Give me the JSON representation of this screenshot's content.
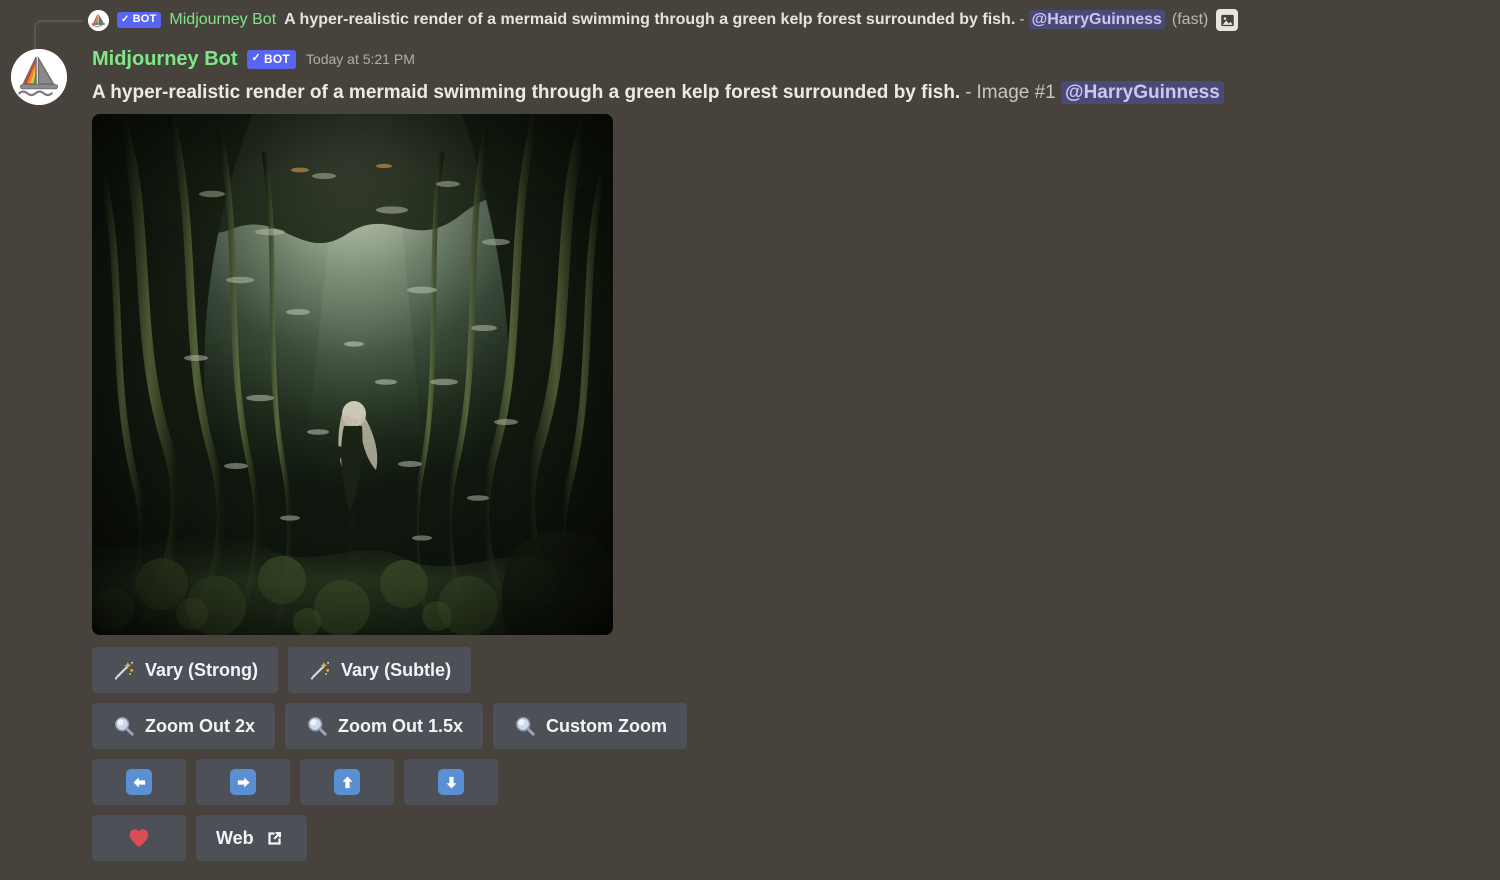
{
  "reply_reference": {
    "avatar_icon": "midjourney-boat-avatar-icon",
    "bot_badge": {
      "check": "✓",
      "label": "BOT"
    },
    "username": "Midjourney Bot",
    "prompt": "A hyper-realistic render of a mermaid swimming through a green kelp forest surrounded by fish.",
    "dash": "-",
    "mention": "@HarryGuinness",
    "mode": "(fast)",
    "attachment_icon": "image-attachment-icon"
  },
  "message": {
    "avatar_icon": "midjourney-boat-avatar-icon",
    "author": "Midjourney Bot",
    "bot_badge": {
      "check": "✓",
      "label": "BOT"
    },
    "timestamp": "Today at 5:21 PM",
    "prompt": "A hyper-realistic render of a mermaid swimming through a green kelp forest surrounded by fish.",
    "dash": "-",
    "image_number": "Image #1",
    "mention": "@HarryGuinness",
    "attachment": {
      "alt": "A hyper-realistic render of a mermaid swimming through a green kelp forest surrounded by fish.",
      "width": "521",
      "height": "521"
    }
  },
  "action_rows": [
    {
      "buttons": [
        {
          "name": "vary-strong",
          "icon": "sparkles-wand-icon",
          "label": "Vary (Strong)"
        },
        {
          "name": "vary-subtle",
          "icon": "sparkles-wand-icon",
          "label": "Vary (Subtle)"
        }
      ]
    },
    {
      "buttons": [
        {
          "name": "zoom-out-2x",
          "icon": "magnifying-glass-icon",
          "label": "Zoom Out 2x"
        },
        {
          "name": "zoom-out-1-5x",
          "icon": "magnifying-glass-icon",
          "label": "Zoom Out 1.5x"
        },
        {
          "name": "custom-zoom",
          "icon": "magnifying-glass-icon",
          "label": "Custom Zoom"
        }
      ]
    },
    {
      "buttons": [
        {
          "name": "pan-left",
          "icon": "arrow-left-icon",
          "label": ""
        },
        {
          "name": "pan-right",
          "icon": "arrow-right-icon",
          "label": ""
        },
        {
          "name": "pan-up",
          "icon": "arrow-up-icon",
          "label": ""
        },
        {
          "name": "pan-down",
          "icon": "arrow-down-icon",
          "label": ""
        }
      ]
    },
    {
      "buttons": [
        {
          "name": "favorite",
          "icon": "red-heart-icon",
          "label": ""
        },
        {
          "name": "open-web",
          "icon": "external-link-icon",
          "label": "Web"
        }
      ]
    }
  ],
  "colors": {
    "app_background": "#47433c",
    "bot_badge": "#5865f2",
    "username_green": "#7ee787",
    "mention_background": "#4b4a77",
    "mention_text": "#c9c7f5",
    "button_background": "#4e5058",
    "button_text": "#f2f3f5",
    "arrow_blue": "#5b8fd4",
    "heart_red": "#dd4c54"
  }
}
